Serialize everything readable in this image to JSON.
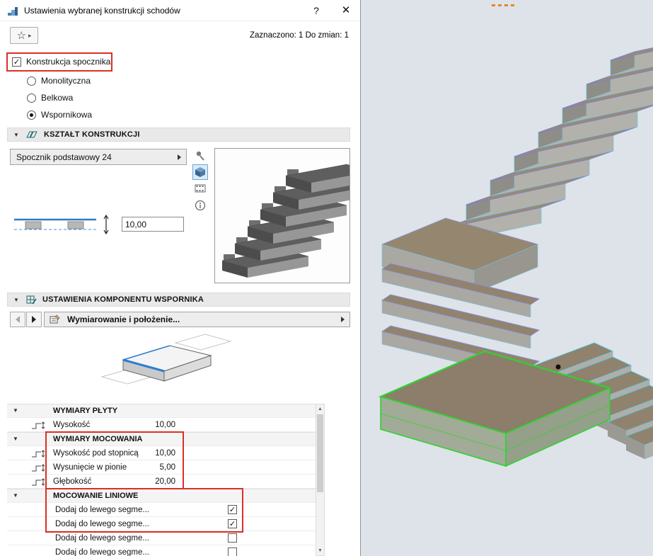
{
  "dialog": {
    "title": "Ustawienia wybranej konstrukcji schodów",
    "help_label": "?",
    "close_label": "✕",
    "toolbar": {
      "status": "Zaznaczono: 1 Do zmian: 1"
    },
    "landing_checkbox": {
      "label": "Konstrukcja spocznika",
      "checked": true
    },
    "radio_options": [
      {
        "label": "Monolityczna",
        "selected": false
      },
      {
        "label": "Belkowa",
        "selected": false
      },
      {
        "label": "Wspornikowa",
        "selected": true
      }
    ],
    "shape_section": {
      "title": "KSZTAŁT KONSTRUKCJI",
      "preset_label": "Spocznik podstawowy 24",
      "thickness_value": "10,00"
    },
    "component_section": {
      "title": "USTAWIENIA KOMPONENTU WSPORNIKA",
      "nav_label": "Wymiarowanie i położenie...",
      "table": {
        "rows": [
          {
            "type": "group",
            "label": "WYMIARY PŁYTY"
          },
          {
            "type": "value",
            "label": "Wysokość",
            "value": "10,00",
            "icon": "height-icon"
          },
          {
            "type": "group",
            "label": "WYMIARY MOCOWANIA"
          },
          {
            "type": "value",
            "label": "Wysokość pod stopnicą",
            "value": "10,00",
            "icon": "height-under-tread-icon"
          },
          {
            "type": "value",
            "label": "Wysunięcie w pionie",
            "value": "5,00",
            "icon": "vertical-offset-icon"
          },
          {
            "type": "value",
            "label": "Głębokość",
            "value": "20,00",
            "icon": "depth-icon"
          },
          {
            "type": "group",
            "label": "MOCOWANIE LINIOWE"
          },
          {
            "type": "check",
            "label": "Dodaj do lewego segme...",
            "checked": true
          },
          {
            "type": "check",
            "label": "Dodaj do lewego segme...",
            "checked": true
          },
          {
            "type": "check",
            "label": "Dodaj do lewego segme...",
            "checked": false
          },
          {
            "type": "check",
            "label": "Dodaj do lewego segme...",
            "checked": false
          }
        ]
      }
    }
  },
  "icons": {
    "collapse": "▼",
    "star": "☆",
    "star_arrow": "▸",
    "check": "✓",
    "scroll_up": "▲",
    "scroll_down": "▼"
  },
  "colors": {
    "highlight_red": "#d93025",
    "selection_green": "#2fd32f",
    "accent_blue": "#2d7dd2"
  }
}
